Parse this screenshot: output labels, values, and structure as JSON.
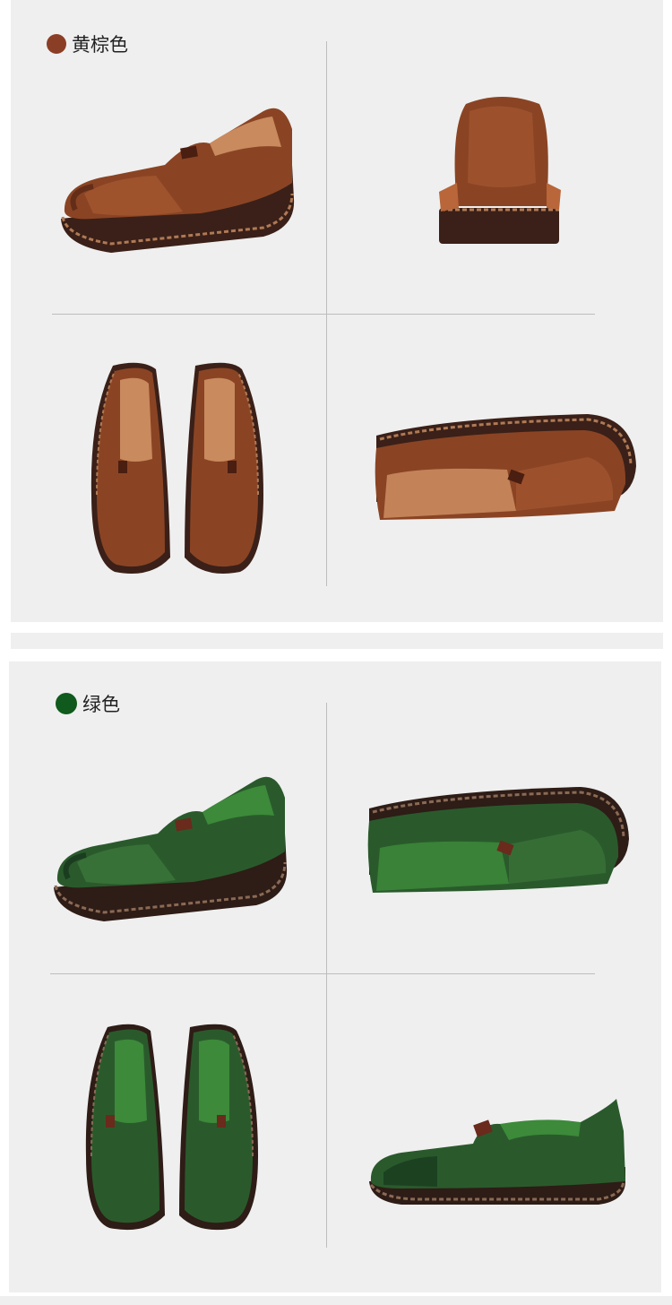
{
  "variants": [
    {
      "label": "黄棕色",
      "swatch": "#8b3e26",
      "leather": "#8a4424",
      "leather_light": "#b8663a",
      "leather_dark": "#4a1e10",
      "lining": "#c98a5e",
      "sole": "#3a2018",
      "views": [
        "side-left",
        "heel-back",
        "top-pair",
        "sole-side"
      ]
    },
    {
      "label": "绿色",
      "swatch": "#0f5a1c",
      "leather": "#2a5a2c",
      "leather_light": "#3f7a3c",
      "leather_dark": "#14301a",
      "lining": "#3c8a3a",
      "sole": "#2e1c16",
      "views": [
        "side-left",
        "sole-side",
        "top-pair",
        "side-right"
      ]
    }
  ]
}
